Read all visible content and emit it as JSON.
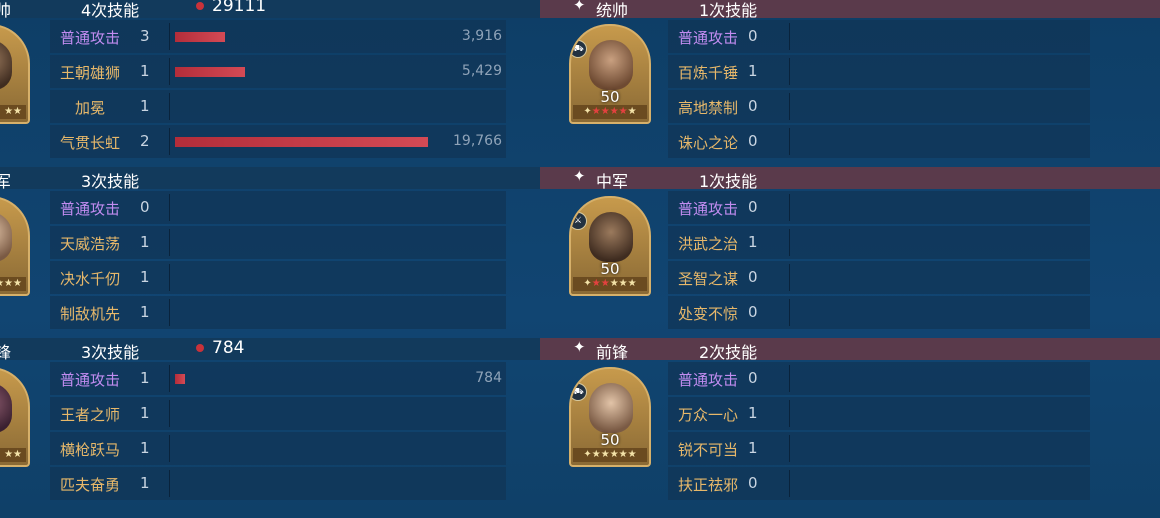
{
  "left": [
    {
      "role": "帅",
      "count": "4次技能",
      "damage": "29111",
      "portrait_stars": "★★",
      "skills": [
        {
          "name": "普通攻击",
          "cnt": "3",
          "val": "3,916",
          "bar": 0.126,
          "basic": true
        },
        {
          "name": "王朝雄狮",
          "cnt": "1",
          "val": "5,429",
          "bar": 0.174
        },
        {
          "name": "加冕",
          "cnt": "1",
          "val": "",
          "bar": 0,
          "center": true
        },
        {
          "name": "气贯长虹",
          "cnt": "2",
          "val": "19,766",
          "bar": 0.633
        }
      ]
    },
    {
      "role": "军",
      "count": "3次技能",
      "damage": "",
      "portrait_stars": "★★★",
      "skills": [
        {
          "name": "普通攻击",
          "cnt": "0",
          "val": "",
          "bar": 0,
          "basic": true
        },
        {
          "name": "天威浩荡",
          "cnt": "1",
          "val": "",
          "bar": 0
        },
        {
          "name": "决水千仞",
          "cnt": "1",
          "val": "",
          "bar": 0
        },
        {
          "name": "制敌机先",
          "cnt": "1",
          "val": "",
          "bar": 0
        }
      ]
    },
    {
      "role": "锋",
      "count": "3次技能",
      "damage": "784",
      "portrait_stars": "★★",
      "skills": [
        {
          "name": "普通攻击",
          "cnt": "1",
          "val": "784",
          "bar": 0.025,
          "basic": true
        },
        {
          "name": "王者之师",
          "cnt": "1",
          "val": "",
          "bar": 0
        },
        {
          "name": "横枪跃马",
          "cnt": "1",
          "val": "",
          "bar": 0
        },
        {
          "name": "匹夫奋勇",
          "cnt": "1",
          "val": "",
          "bar": 0
        }
      ]
    }
  ],
  "right": [
    {
      "star": "✦",
      "role": "统帅",
      "count": "1次技能",
      "level": "50",
      "stars_red": "★★★★",
      "stars_gold": "★",
      "skills": [
        {
          "name": "普通攻击",
          "cnt": "0",
          "basic": true
        },
        {
          "name": "百炼千锤",
          "cnt": "1"
        },
        {
          "name": "高地禁制",
          "cnt": "0"
        },
        {
          "name": "诛心之论",
          "cnt": "0"
        }
      ]
    },
    {
      "star": "✦",
      "role": "中军",
      "count": "1次技能",
      "level": "50",
      "stars_red": "★★",
      "stars_gold": "★★★",
      "skills": [
        {
          "name": "普通攻击",
          "cnt": "0",
          "basic": true
        },
        {
          "name": "洪武之治",
          "cnt": "1"
        },
        {
          "name": "圣智之谋",
          "cnt": "0"
        },
        {
          "name": "处变不惊",
          "cnt": "0"
        }
      ]
    },
    {
      "star": "✦",
      "role": "前锋",
      "count": "2次技能",
      "level": "50",
      "stars_red": "",
      "stars_gold": "★★★★★",
      "skills": [
        {
          "name": "普通攻击",
          "cnt": "0",
          "basic": true
        },
        {
          "name": "万众一心",
          "cnt": "1"
        },
        {
          "name": "锐不可当",
          "cnt": "1"
        },
        {
          "name": "扶正祛邪",
          "cnt": "0"
        }
      ]
    }
  ],
  "colors": {
    "background": "#0f3f67",
    "header_right": "#5a3a4b",
    "basic_skill": "#c18cf0",
    "skill": "#e7b86a",
    "bar": "#c8323a"
  }
}
